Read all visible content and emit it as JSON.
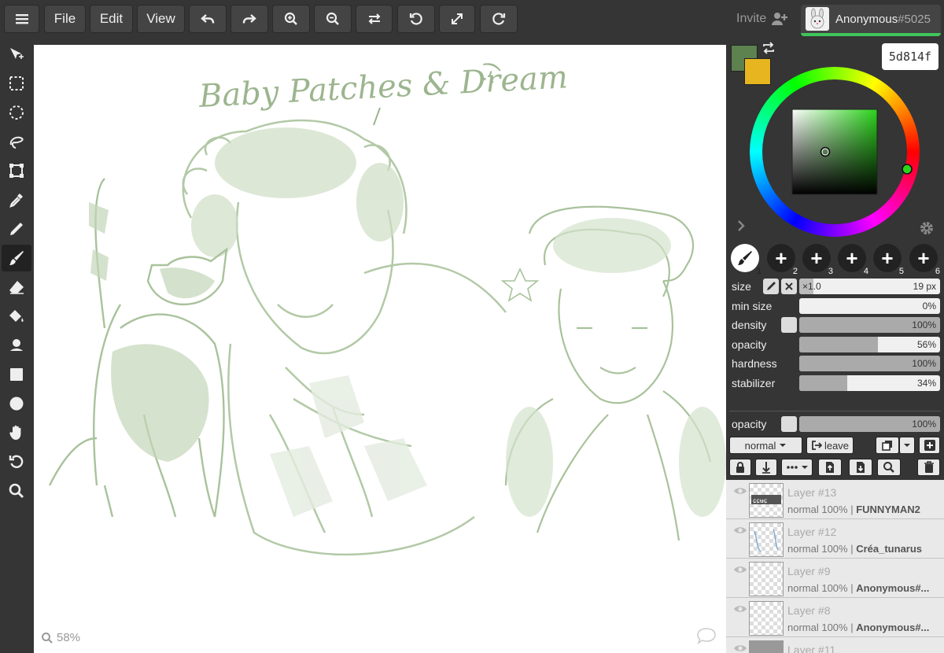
{
  "toolbar": {
    "menu": [
      "File",
      "Edit",
      "View"
    ],
    "invite_label": "Invite",
    "user_name": "Anonymous",
    "user_tag": "#5025"
  },
  "canvas": {
    "title_text": "Baby Patches & Dream",
    "smiley": ":-)",
    "zoom": "58%"
  },
  "color": {
    "primary": "#5d814f",
    "secondary": "#e6b520",
    "hex_value": "5d814f"
  },
  "brushes": [
    "1",
    "2",
    "3",
    "4",
    "5",
    "6"
  ],
  "brush_settings": {
    "size_label": "size",
    "size_multiplier": "×1.0",
    "size_value": "19 px",
    "min_size_label": "min size",
    "min_size_value": "0%",
    "min_size_level": 0,
    "density_label": "density",
    "density_value": "100%",
    "density_level": 1,
    "opacity_label": "opacity",
    "opacity_value": "56%",
    "opacity_level": 0.56,
    "hardness_label": "hardness",
    "hardness_value": "100%",
    "hardness_level": 1,
    "stabilizer_label": "stabilizer",
    "stabilizer_value": "34%",
    "stabilizer_level": 0.34
  },
  "layer_controls": {
    "opacity_label": "opacity",
    "opacity_value": "100%",
    "opacity_level": 1,
    "blend_mode": "normal",
    "leave_label": "leave"
  },
  "layers": [
    {
      "name": "Layer #13",
      "mode": "normal 100%",
      "owner": "FUNNYMAN2"
    },
    {
      "name": "Layer #12",
      "mode": "normal 100%",
      "owner": "Créa_tunarus"
    },
    {
      "name": "Layer #9",
      "mode": "normal 100%",
      "owner": "Anonymous#..."
    },
    {
      "name": "Layer #8",
      "mode": "normal 100%",
      "owner": "Anonymous#..."
    },
    {
      "name": "Layer #11",
      "mode": "",
      "owner": ""
    }
  ]
}
